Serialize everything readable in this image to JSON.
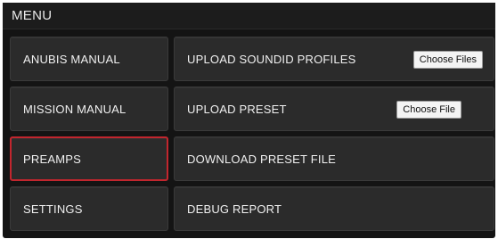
{
  "menu": {
    "title": "MENU"
  },
  "left_items": [
    {
      "label": "ANUBIS MANUAL"
    },
    {
      "label": "MISSION MANUAL"
    },
    {
      "label": "PREAMPS"
    },
    {
      "label": "SETTINGS"
    }
  ],
  "right_items": [
    {
      "label": "UPLOAD SOUNDID PROFILES",
      "button": "Choose Files"
    },
    {
      "label": "UPLOAD PRESET",
      "button": "Choose File"
    },
    {
      "label": "DOWNLOAD PRESET FILE"
    },
    {
      "label": "DEBUG REPORT"
    }
  ],
  "selected_item": "PREAMPS",
  "colors": {
    "selected_outline": "#c2262e",
    "tile_background": "#2b2b2b",
    "panel_background": "#141414"
  }
}
